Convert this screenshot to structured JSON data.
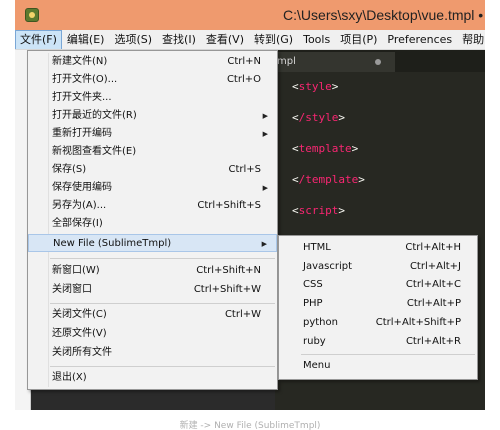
{
  "window": {
    "title": "C:\\Users\\sxy\\Desktop\\vue.tmpl • - S"
  },
  "menubar": {
    "items": [
      {
        "label": "文件(F)"
      },
      {
        "label": "编辑(E)"
      },
      {
        "label": "选项(S)"
      },
      {
        "label": "查找(I)"
      },
      {
        "label": "查看(V)"
      },
      {
        "label": "转到(G)"
      },
      {
        "label": "Tools"
      },
      {
        "label": "项目(P)"
      },
      {
        "label": "Preferences"
      },
      {
        "label": "帮助(H)"
      }
    ]
  },
  "editor": {
    "tab_label": "mpl",
    "code_lines": [
      {
        "tag": "style",
        "open": "<",
        "close": ">"
      },
      {
        "tag": "/style",
        "open": "<",
        "close": ">"
      },
      {
        "tag": "template",
        "open": "<",
        "close": ">"
      },
      {
        "tag": "/template",
        "open": "<",
        "close": ">"
      },
      {
        "tag": "script",
        "open": "<",
        "close": ">"
      }
    ]
  },
  "file_menu": {
    "items": [
      {
        "label": "新建文件(N)",
        "shortcut": "Ctrl+N"
      },
      {
        "label": "打开文件(O)...",
        "shortcut": "Ctrl+O"
      },
      {
        "label": "打开文件夹...",
        "shortcut": ""
      },
      {
        "label": "打开最近的文件(R)",
        "shortcut": "",
        "arrow": "▶"
      },
      {
        "label": "重新打开编码",
        "shortcut": "",
        "arrow": "▶"
      },
      {
        "label": "新视图查看文件(E)",
        "shortcut": ""
      },
      {
        "label": "保存(S)",
        "shortcut": "Ctrl+S"
      },
      {
        "label": "保存使用编码",
        "shortcut": "",
        "arrow": "▶"
      },
      {
        "label": "另存为(A)...",
        "shortcut": "Ctrl+Shift+S"
      },
      {
        "label": "全部保存(I)",
        "shortcut": ""
      },
      {
        "label": "New File (SublimeTmpl)",
        "shortcut": "",
        "arrow": "▶"
      },
      {
        "label": "新窗口(W)",
        "shortcut": "Ctrl+Shift+N"
      },
      {
        "label": "关闭窗口",
        "shortcut": "Ctrl+Shift+W"
      },
      {
        "label": "关闭文件(C)",
        "shortcut": "Ctrl+W"
      },
      {
        "label": "还原文件(V)",
        "shortcut": ""
      },
      {
        "label": "关闭所有文件",
        "shortcut": ""
      },
      {
        "label": "退出(X)",
        "shortcut": ""
      }
    ]
  },
  "sub_menu": {
    "items": [
      {
        "label": "HTML",
        "shortcut": "Ctrl+Alt+H"
      },
      {
        "label": "Javascript",
        "shortcut": "Ctrl+Alt+J"
      },
      {
        "label": "CSS",
        "shortcut": "Ctrl+Alt+C"
      },
      {
        "label": "PHP",
        "shortcut": "Ctrl+Alt+P"
      },
      {
        "label": "python",
        "shortcut": "Ctrl+Alt+Shift+P"
      },
      {
        "label": "ruby",
        "shortcut": "Ctrl+Alt+R"
      },
      {
        "label": "Menu",
        "shortcut": ""
      }
    ]
  },
  "caption": "新建 -> New File (SublimeTmpl)",
  "colors": {
    "titlebar": "#ef9a6e",
    "editor_bg": "#272822",
    "tag_color": "#f92672",
    "menu_bg": "#f2f2f2",
    "highlight": "#d8e6f5"
  }
}
